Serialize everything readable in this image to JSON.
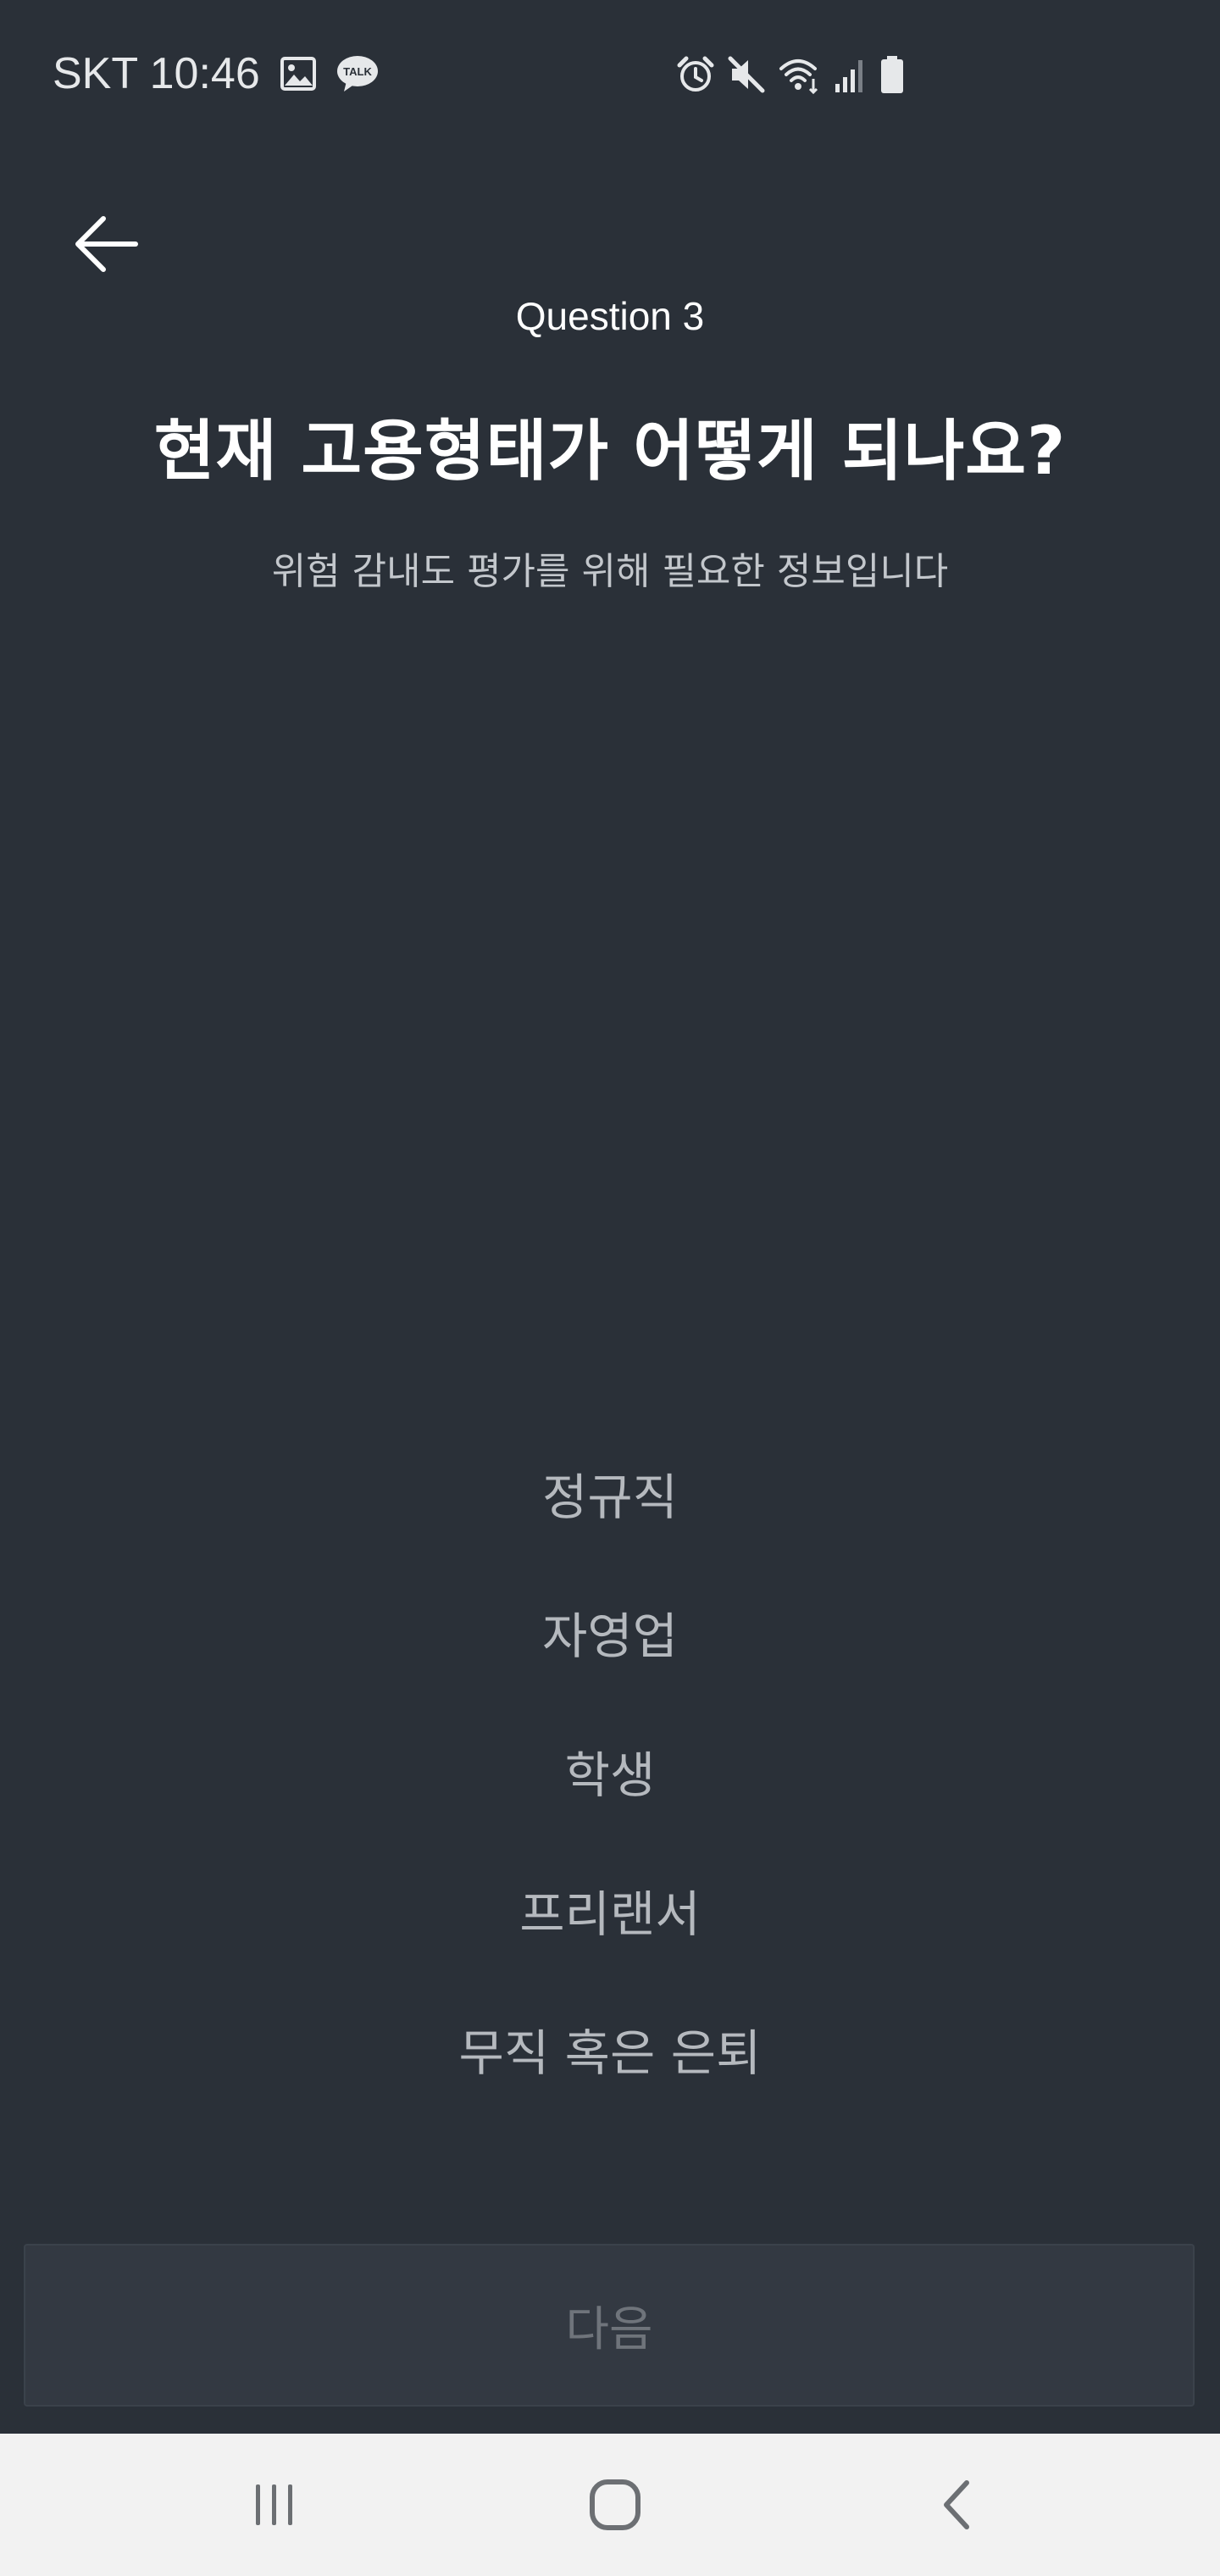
{
  "status_bar": {
    "carrier_time": "SKT 10:46",
    "left_icons": [
      "image-icon",
      "kakao-talk-icon"
    ],
    "right_icons": [
      "alarm-icon",
      "mute-icon",
      "wifi-icon",
      "signal-icon",
      "battery-icon"
    ],
    "talk_badge": "TALK"
  },
  "header": {
    "back_icon": "arrow-left-icon",
    "question_number": "Question 3",
    "title": "현재 고용형태가 어떻게 되나요?",
    "subtitle": "위험 감내도 평가를 위해 필요한 정보입니다"
  },
  "options": [
    {
      "label": "정규직"
    },
    {
      "label": "자영업"
    },
    {
      "label": "학생"
    },
    {
      "label": "프리랜서"
    },
    {
      "label": "무직 혹은 은퇴"
    }
  ],
  "next_button": {
    "label": "다음",
    "enabled": false
  },
  "nav_bar": {
    "items": [
      "recent-apps-icon",
      "home-icon",
      "back-icon"
    ]
  },
  "colors": {
    "background": "#2a3038",
    "option_text": "#b5b9be",
    "subtitle_text": "#c3c7cc",
    "button_bg": "#333942",
    "button_text_disabled": "#6f747b",
    "nav_bg": "#f2f2f2"
  }
}
